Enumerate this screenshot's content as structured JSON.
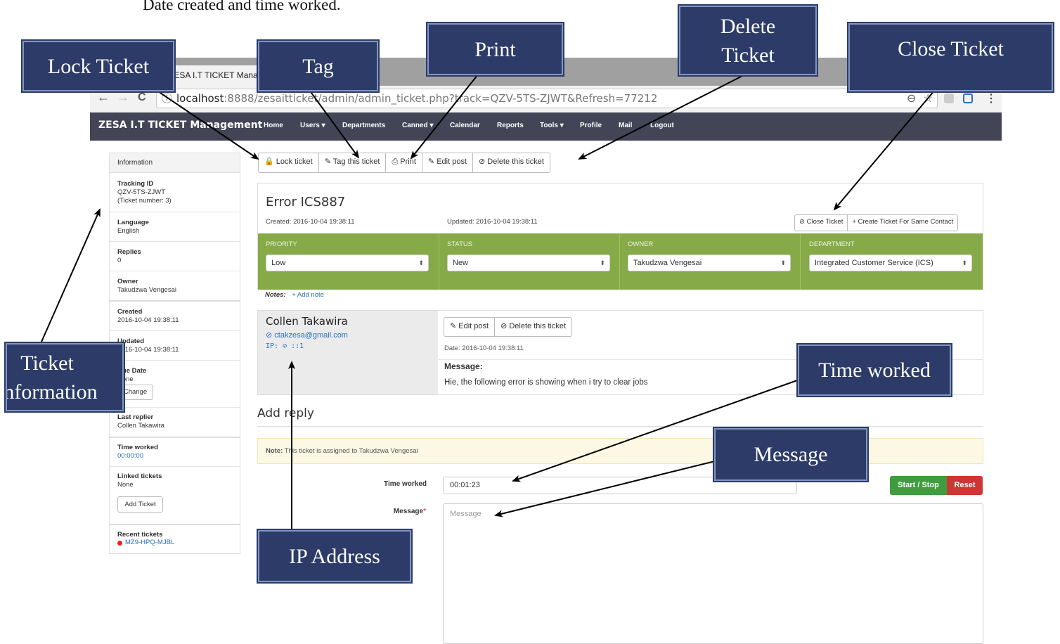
{
  "document": {
    "intro_text": "Date created and time worked."
  },
  "browser": {
    "tab_title": "ZESA I.T TICKET Management",
    "url_host": "localhost",
    "url_path": ":8888/zesaitticket/admin/admin_ticket.php?track=QZV-5TS-ZJWT&Refresh=77212",
    "back_glyph": "←",
    "forward_glyph": "→",
    "reload_glyph": "C",
    "info_glyph": "ⓘ",
    "zoom_glyph": "⊖",
    "star_glyph": "☆",
    "menu_glyph": "⋮"
  },
  "navbar": {
    "brand": "ZESA I.T TICKET Management",
    "items": [
      "Home",
      "Users ▾",
      "Departments",
      "Canned ▾",
      "Calendar",
      "Reports",
      "Tools ▾",
      "Profile",
      "Mail",
      "Logout"
    ]
  },
  "sidebar": {
    "header": "Information",
    "tracking_label": "Tracking ID",
    "tracking_id": "QZV-5TS-ZJWT",
    "ticket_number": "(Ticket number: 3)",
    "language_label": "Language",
    "language": "English",
    "replies_label": "Replies",
    "replies": "0",
    "owner_label": "Owner",
    "owner": "Takudzwa Vengesai",
    "created_label": "Created",
    "created": "2016-10-04 19:38:11",
    "updated_label": "Updated",
    "updated": "2016-10-04 19:38:11",
    "due_label": "Due Date",
    "due": "None",
    "change_button": "Change",
    "last_replier_label": "Last replier",
    "last_replier": "Collen Takawira",
    "time_worked_label": "Time worked",
    "time_worked": "00:00:00",
    "linked_label": "Linked tickets",
    "linked": "None",
    "add_ticket_button": "Add Ticket",
    "recent_label": "Recent tickets",
    "recent_ticket": "MZ9-HPQ-MJBL"
  },
  "toolbar": {
    "lock": "🔒 Lock ticket",
    "tag": "✎ Tag this ticket",
    "print": "⎙ Print",
    "edit": "✎ Edit post",
    "delete": "⊘ Delete this ticket"
  },
  "ticket": {
    "subject": "Error ICS887",
    "created": "Created: 2016-10-04 19:38:11",
    "updated": "Updated: 2016-10-04 19:38:11",
    "close_button": "⊘ Close Ticket",
    "create_same_button": "+ Create Ticket For Same Contact",
    "priority_label": "PRIORITY",
    "priority": "Low",
    "status_label": "STATUS",
    "status": "New",
    "owner_label": "OWNER",
    "owner": "Takudzwa Vengesai",
    "department_label": "DEPARTMENT",
    "department": "Integrated Customer Service (ICS)",
    "select_arrow": "⬍",
    "notes_label": "Notes:",
    "add_note": "+ Add note",
    "green_color": "#85aa47"
  },
  "post": {
    "author": "Collen Takawira",
    "email": "⊘ ctakzesa@gmail.com",
    "ip": "IP: ⊘ ::1",
    "edit_button": "✎ Edit post",
    "delete_button": "⊘ Delete this ticket",
    "date": "Date: 2016-10-04 19:38:11",
    "message_label": "Message:",
    "message": "Hie, the following error is showing when i try to clear jobs"
  },
  "reply": {
    "title": "Add reply",
    "note_label": "Note:",
    "note_text": " This ticket is assigned to Takudzwa Vengesai",
    "time_worked_label": "Time worked",
    "time_worked_value": "00:01:23",
    "start_stop": "Start / Stop",
    "reset": "Reset",
    "message_label": "Message",
    "required_mark": "*",
    "message_placeholder": "Message"
  },
  "callouts": {
    "lock_ticket": "Lock Ticket",
    "tag": "Tag",
    "print": "Print",
    "delete_ticket": "Delete Ticket",
    "close_ticket": "Close Ticket",
    "ticket_information": "Ticket Information",
    "time_worked": "Time worked",
    "message": "Message",
    "ip_address": "IP Address",
    "color": "#2c3b67"
  }
}
